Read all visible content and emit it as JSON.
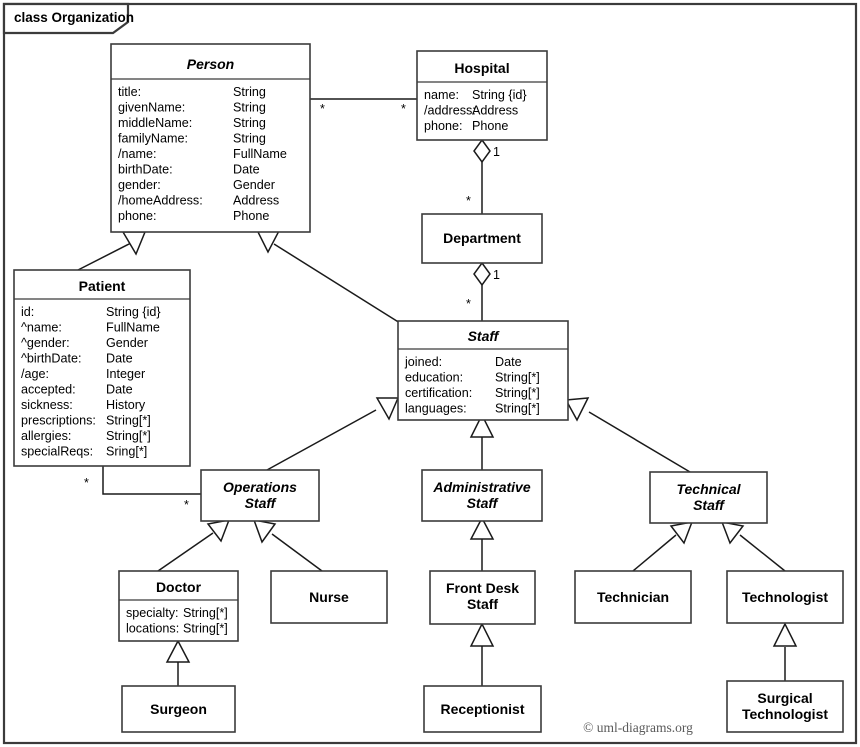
{
  "frame": {
    "label": "class Organization",
    "credit": "© uml-diagrams.org"
  },
  "classes": {
    "person": {
      "name": "Person",
      "abstract": true,
      "attributes": [
        {
          "name": "title:",
          "type": "String"
        },
        {
          "name": "givenName:",
          "type": "String"
        },
        {
          "name": "middleName:",
          "type": "String"
        },
        {
          "name": "familyName:",
          "type": "String"
        },
        {
          "name": "/name:",
          "type": "FullName"
        },
        {
          "name": "birthDate:",
          "type": "Date"
        },
        {
          "name": "gender:",
          "type": "Gender"
        },
        {
          "name": "/homeAddress:",
          "type": "Address"
        },
        {
          "name": "phone:",
          "type": "Phone"
        }
      ]
    },
    "hospital": {
      "name": "Hospital",
      "abstract": false,
      "attributes": [
        {
          "name": "name:",
          "type": "String {id}"
        },
        {
          "name": "/address:",
          "type": "Address"
        },
        {
          "name": "phone:",
          "type": "Phone"
        }
      ]
    },
    "department": {
      "name": "Department",
      "abstract": false,
      "attributes": []
    },
    "patient": {
      "name": "Patient",
      "abstract": false,
      "attributes": [
        {
          "name": "id:",
          "type": "String {id}"
        },
        {
          "name": "^name:",
          "type": "FullName"
        },
        {
          "name": "^gender:",
          "type": "Gender"
        },
        {
          "name": "^birthDate:",
          "type": "Date"
        },
        {
          "name": "/age:",
          "type": "Integer"
        },
        {
          "name": "accepted:",
          "type": "Date"
        },
        {
          "name": "sickness:",
          "type": "History"
        },
        {
          "name": "prescriptions:",
          "type": "String[*]"
        },
        {
          "name": "allergies:",
          "type": "String[*]"
        },
        {
          "name": "specialReqs:",
          "type": "Sring[*]"
        }
      ]
    },
    "staff": {
      "name": "Staff",
      "abstract": true,
      "attributes": [
        {
          "name": "joined:",
          "type": "Date"
        },
        {
          "name": "education:",
          "type": "String[*]"
        },
        {
          "name": "certification:",
          "type": "String[*]"
        },
        {
          "name": "languages:",
          "type": "String[*]"
        }
      ]
    },
    "operations_staff": {
      "name": "Operations Staff",
      "line1": "Operations",
      "line2": "Staff",
      "abstract": true,
      "attributes": []
    },
    "administrative_staff": {
      "name": "Administrative Staff",
      "line1": "Administrative",
      "line2": "Staff",
      "abstract": true,
      "attributes": []
    },
    "technical_staff": {
      "name": "Technical Staff",
      "line1": "Technical",
      "line2": "Staff",
      "abstract": true,
      "attributes": []
    },
    "doctor": {
      "name": "Doctor",
      "abstract": false,
      "attributes": [
        {
          "name": "specialty:",
          "type": "String[*]"
        },
        {
          "name": "locations:",
          "type": "String[*]"
        }
      ]
    },
    "nurse": {
      "name": "Nurse",
      "abstract": false,
      "attributes": []
    },
    "front_desk_staff": {
      "name": "Front Desk Staff",
      "line1": "Front Desk",
      "line2": "Staff",
      "abstract": false,
      "attributes": []
    },
    "technician": {
      "name": "Technician",
      "abstract": false,
      "attributes": []
    },
    "technologist": {
      "name": "Technologist",
      "abstract": false,
      "attributes": []
    },
    "surgeon": {
      "name": "Surgeon",
      "abstract": false,
      "attributes": []
    },
    "receptionist": {
      "name": "Receptionist",
      "abstract": false,
      "attributes": []
    },
    "surgical_technologist": {
      "name": "Surgical Technologist",
      "line1": "Surgical",
      "line2": "Technologist",
      "abstract": false,
      "attributes": []
    }
  },
  "multiplicities": {
    "person_hospital_person_end": "*",
    "person_hospital_hospital_end": "*",
    "hospital_department_hospital_end": "1",
    "hospital_department_department_end": "*",
    "department_staff_department_end": "1",
    "department_staff_staff_end": "*",
    "patient_operations_patient_end": "*",
    "patient_operations_operations_end": "*"
  },
  "relationships": [
    {
      "kind": "association",
      "from": "Person",
      "to": "Hospital"
    },
    {
      "kind": "aggregation",
      "from": "Hospital",
      "to": "Department"
    },
    {
      "kind": "aggregation",
      "from": "Department",
      "to": "Staff"
    },
    {
      "kind": "association",
      "from": "Patient",
      "to": "Operations Staff"
    },
    {
      "kind": "generalization",
      "from": "Patient",
      "to": "Person"
    },
    {
      "kind": "generalization",
      "from": "Staff",
      "to": "Person"
    },
    {
      "kind": "generalization",
      "from": "Operations Staff",
      "to": "Staff"
    },
    {
      "kind": "generalization",
      "from": "Administrative Staff",
      "to": "Staff"
    },
    {
      "kind": "generalization",
      "from": "Technical Staff",
      "to": "Staff"
    },
    {
      "kind": "generalization",
      "from": "Doctor",
      "to": "Operations Staff"
    },
    {
      "kind": "generalization",
      "from": "Nurse",
      "to": "Operations Staff"
    },
    {
      "kind": "generalization",
      "from": "Front Desk Staff",
      "to": "Administrative Staff"
    },
    {
      "kind": "generalization",
      "from": "Technician",
      "to": "Technical Staff"
    },
    {
      "kind": "generalization",
      "from": "Technologist",
      "to": "Technical Staff"
    },
    {
      "kind": "generalization",
      "from": "Surgeon",
      "to": "Doctor"
    },
    {
      "kind": "generalization",
      "from": "Receptionist",
      "to": "Front Desk Staff"
    },
    {
      "kind": "generalization",
      "from": "Surgical Technologist",
      "to": "Technologist"
    }
  ]
}
